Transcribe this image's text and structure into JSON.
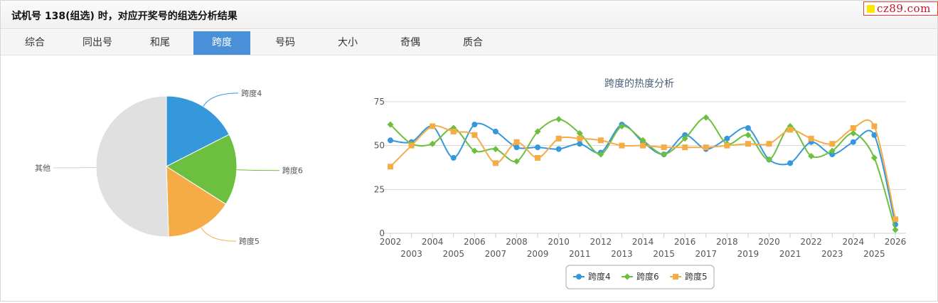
{
  "page": {
    "title": "试机号 138(组选) 时，对应开奖号的组选分析结果",
    "brand": "cz89.com"
  },
  "tabs": [
    {
      "label": "综合",
      "active": false
    },
    {
      "label": "同出号",
      "active": false
    },
    {
      "label": "和尾",
      "active": false
    },
    {
      "label": "跨度",
      "active": true
    },
    {
      "label": "号码",
      "active": false
    },
    {
      "label": "大小",
      "active": false
    },
    {
      "label": "奇偶",
      "active": false
    },
    {
      "label": "质合",
      "active": false
    }
  ],
  "colors": {
    "blue": "#3498db",
    "green": "#6cbf3f",
    "orange": "#f5ac47",
    "gray": "#e0e0e0",
    "active_tab": "#4a90d9"
  },
  "chart_data": [
    {
      "type": "pie",
      "slices": [
        {
          "label": "跨度4",
          "value": 17.5,
          "color": "#3498db"
        },
        {
          "label": "跨度6",
          "value": 16.5,
          "color": "#6cbf3f"
        },
        {
          "label": "跨度5",
          "value": 15.5,
          "color": "#f5ac47"
        },
        {
          "label": "其他",
          "value": 50.5,
          "color": "#e0e0e0"
        }
      ]
    },
    {
      "type": "line",
      "title": "跨度的热度分析",
      "x": [
        "2002",
        "2003",
        "2004",
        "2005",
        "2006",
        "2007",
        "2008",
        "2009",
        "2010",
        "2011",
        "2012",
        "2013",
        "2014",
        "2015",
        "2016",
        "2017",
        "2018",
        "2019",
        "2020",
        "2021",
        "2022",
        "2023",
        "2024",
        "2025",
        "2026"
      ],
      "ylim": [
        0,
        75
      ],
      "yticks": [
        0,
        25,
        50,
        75
      ],
      "grid": true,
      "legend": "bottom-center",
      "series": [
        {
          "name": "跨度4",
          "color": "#3498db",
          "marker": "circle",
          "values": [
            53,
            52,
            61,
            43,
            62,
            58,
            49,
            49,
            48,
            51,
            46,
            62,
            52,
            45,
            56,
            48,
            54,
            60,
            42,
            40,
            52,
            45,
            52,
            56,
            5
          ]
        },
        {
          "name": "跨度6",
          "color": "#6cbf3f",
          "marker": "diamond",
          "values": [
            62,
            51,
            51,
            60,
            47,
            48,
            41,
            58,
            65,
            57,
            45,
            61,
            53,
            45,
            54,
            66,
            51,
            56,
            42,
            61,
            44,
            47,
            57,
            43,
            2
          ]
        },
        {
          "name": "跨度5",
          "color": "#f5ac47",
          "marker": "square",
          "values": [
            38,
            50,
            61,
            58,
            56,
            40,
            52,
            43,
            54,
            54,
            53,
            50,
            50,
            49,
            49,
            49,
            50,
            51,
            51,
            59,
            54,
            51,
            60,
            61,
            8
          ]
        }
      ]
    }
  ]
}
